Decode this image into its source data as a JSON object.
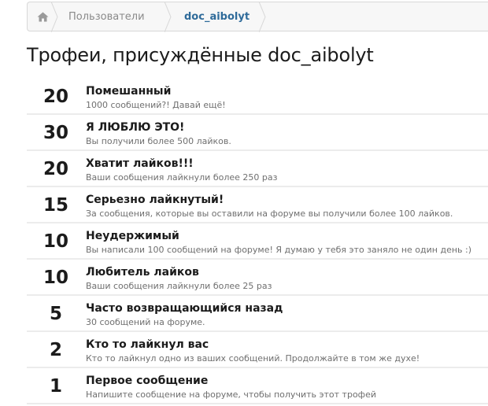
{
  "breadcrumb": {
    "home_icon": "home-icon",
    "items": [
      {
        "label": "Пользователи"
      },
      {
        "label": "doc_aibolyt"
      }
    ]
  },
  "page_title": "Трофеи, присуждённые doc_aibolyt",
  "trophies": [
    {
      "points": "20",
      "title": "Помешанный",
      "description": "1000 сообщений?! Давай ещё!"
    },
    {
      "points": "30",
      "title": "Я ЛЮБЛЮ ЭТО!",
      "description": "Вы получили более 500 лайков."
    },
    {
      "points": "20",
      "title": "Хватит лайков!!!",
      "description": "Ваши сообщения лайкнули более 250 раз"
    },
    {
      "points": "15",
      "title": "Серьезно лайкнутый!",
      "description": "За сообщения, которые вы оставили на форуме вы получили более 100 лайков."
    },
    {
      "points": "10",
      "title": "Неудержимый",
      "description": "Вы написали 100 сообщений на форуме! Я думаю у тебя это заняло не один день :)"
    },
    {
      "points": "10",
      "title": "Любитель лайков",
      "description": "Ваши сообщения лайкнули более 25 раз"
    },
    {
      "points": "5",
      "title": "Часто возвращающийся назад",
      "description": "30 сообщений на форуме."
    },
    {
      "points": "2",
      "title": "Кто то лайкнул вас",
      "description": "Кто то лайкнул одно из ваших сообщений. Продолжайте в том же духе!"
    },
    {
      "points": "1",
      "title": "Первое сообщение",
      "description": "Напишите сообщение на форуме, чтобы получить этот трофей"
    }
  ]
}
